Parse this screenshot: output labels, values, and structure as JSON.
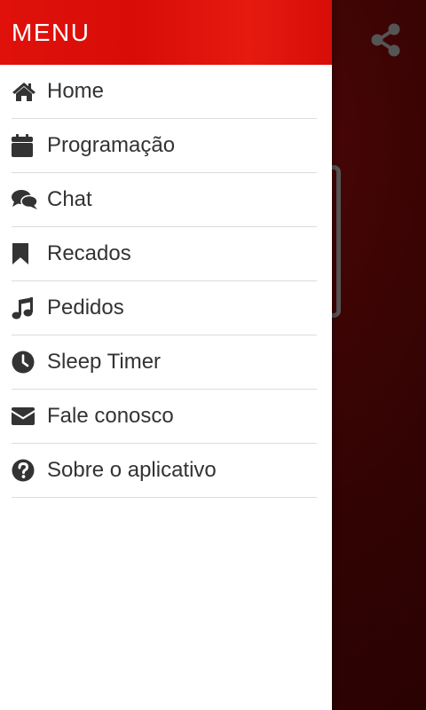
{
  "drawer": {
    "title": "MENU",
    "items": [
      {
        "label": "Home",
        "icon": "home-icon"
      },
      {
        "label": "Programação",
        "icon": "calendar-icon"
      },
      {
        "label": "Chat",
        "icon": "chat-icon"
      },
      {
        "label": "Recados",
        "icon": "bookmark-icon"
      },
      {
        "label": "Pedidos",
        "icon": "music-icon"
      },
      {
        "label": "Sleep Timer",
        "icon": "clock-icon"
      },
      {
        "label": "Fale conosco",
        "icon": "envelope-icon"
      },
      {
        "label": "Sobre o aplicativo",
        "icon": "question-circle-icon"
      }
    ]
  },
  "header_actions": {
    "share_icon": "share-icon"
  },
  "colors": {
    "header_red": "#e0110b",
    "backdrop_dark": "#2a0303",
    "icon_color": "#333333",
    "text_color": "#333333",
    "divider": "#dcdcdc"
  }
}
